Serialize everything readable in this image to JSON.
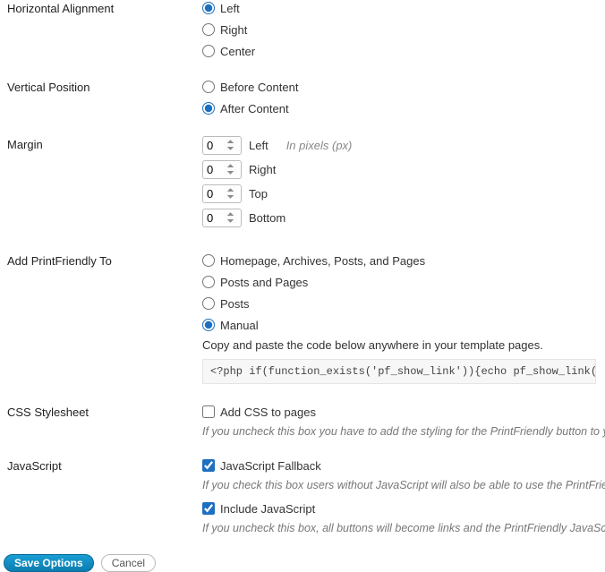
{
  "alignment": {
    "label": "Horizontal Alignment",
    "options": {
      "left": "Left",
      "right": "Right",
      "center": "Center"
    },
    "selected": "left"
  },
  "position": {
    "label": "Vertical Position",
    "options": {
      "before": "Before Content",
      "after": "After Content"
    },
    "selected": "after"
  },
  "margin": {
    "label": "Margin",
    "hint": "In pixels (px)",
    "left": {
      "value": "0",
      "label": "Left"
    },
    "right": {
      "value": "0",
      "label": "Right"
    },
    "top": {
      "value": "0",
      "label": "Top"
    },
    "bottom": {
      "value": "0",
      "label": "Bottom"
    }
  },
  "addto": {
    "label": "Add PrintFriendly To",
    "options": {
      "all": "Homepage, Archives, Posts, and Pages",
      "pp": "Posts and Pages",
      "posts": "Posts",
      "manual": "Manual"
    },
    "selected": "manual",
    "desc": "Copy and paste the code below anywhere in your template pages.",
    "code": "<?php if(function_exists('pf_show_link')){echo pf_show_link();} ?>"
  },
  "css": {
    "label": "CSS Stylesheet",
    "checkbox": "Add CSS to pages",
    "checked": false,
    "help": "If you uncheck this box you have to add the styling for the PrintFriendly button to yo"
  },
  "js": {
    "label": "JavaScript",
    "fallback": {
      "label": "JavaScript Fallback",
      "checked": true
    },
    "fallback_help": "If you check this box users without JavaScript will also be able to use the PrintFrien",
    "include": {
      "label": "Include JavaScript",
      "checked": true
    },
    "include_help": "If you uncheck this box, all buttons will become links and the PrintFriendly JavaScri"
  },
  "actions": {
    "save": "Save Options",
    "cancel": "Cancel"
  }
}
